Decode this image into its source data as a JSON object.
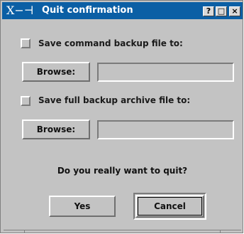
{
  "window": {
    "title": "Quit confirmation",
    "app_icon_glyph": "X−⊣",
    "controls": {
      "help": "?",
      "maximize": "□",
      "close": "×"
    }
  },
  "options": [
    {
      "checkbox_label": "Save command backup file to:",
      "checked": false,
      "browse_label": "Browse:",
      "path_value": ""
    },
    {
      "checkbox_label": "Save full backup archive file to:",
      "checked": false,
      "browse_label": "Browse:",
      "path_value": ""
    }
  ],
  "prompt": "Do you really want to quit?",
  "buttons": {
    "yes": "Yes",
    "cancel": "Cancel",
    "default": "cancel"
  },
  "colors": {
    "titlebar": "#0b5fa5",
    "face": "#c3c3c3"
  }
}
